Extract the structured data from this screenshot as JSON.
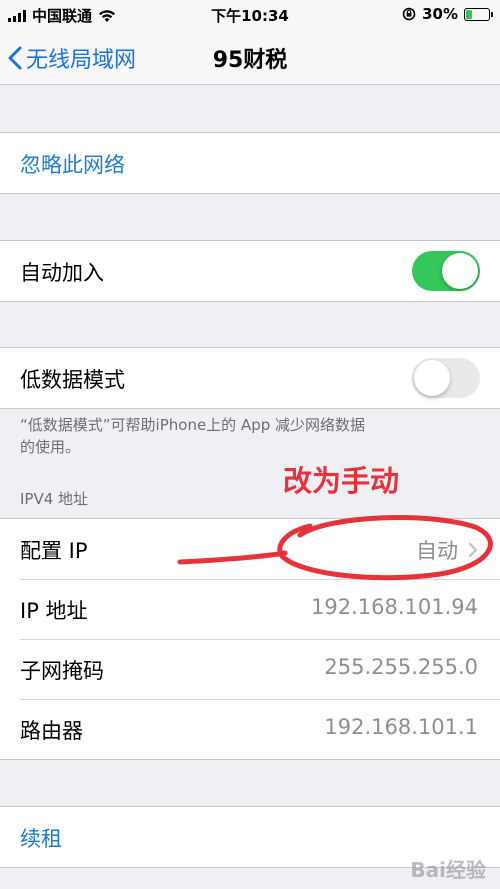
{
  "status": {
    "carrier": "中国联通",
    "time": "下午10:34",
    "battery_text": "30%",
    "battery_level": 0.3
  },
  "nav": {
    "back_label": "无线局域网",
    "title": "95财税"
  },
  "forget": {
    "label": "忽略此网络"
  },
  "auto_join": {
    "label": "自动加入",
    "enabled": true
  },
  "low_data": {
    "label": "低数据模式",
    "enabled": false,
    "footnote_line1": "“低数据模式”可帮助iPhone上的 App 减少网络数据",
    "footnote_line2": "的使用。"
  },
  "ipv4": {
    "header": "IPV4 地址",
    "rows": [
      {
        "label": "配置 IP",
        "value": "自动"
      },
      {
        "label": "IP 地址",
        "value": "192.168.101.94"
      },
      {
        "label": "子网掩码",
        "value": "255.255.255.0"
      },
      {
        "label": "路由器",
        "value": "192.168.101.1"
      }
    ]
  },
  "renew": {
    "label": "续租"
  },
  "annotation": {
    "text": "改为手动"
  },
  "watermark": {
    "text": "Bai经验"
  },
  "colors": {
    "accent": "#1a7cd6",
    "toggle_on": "#34c759",
    "annotation": "#e8323a"
  }
}
